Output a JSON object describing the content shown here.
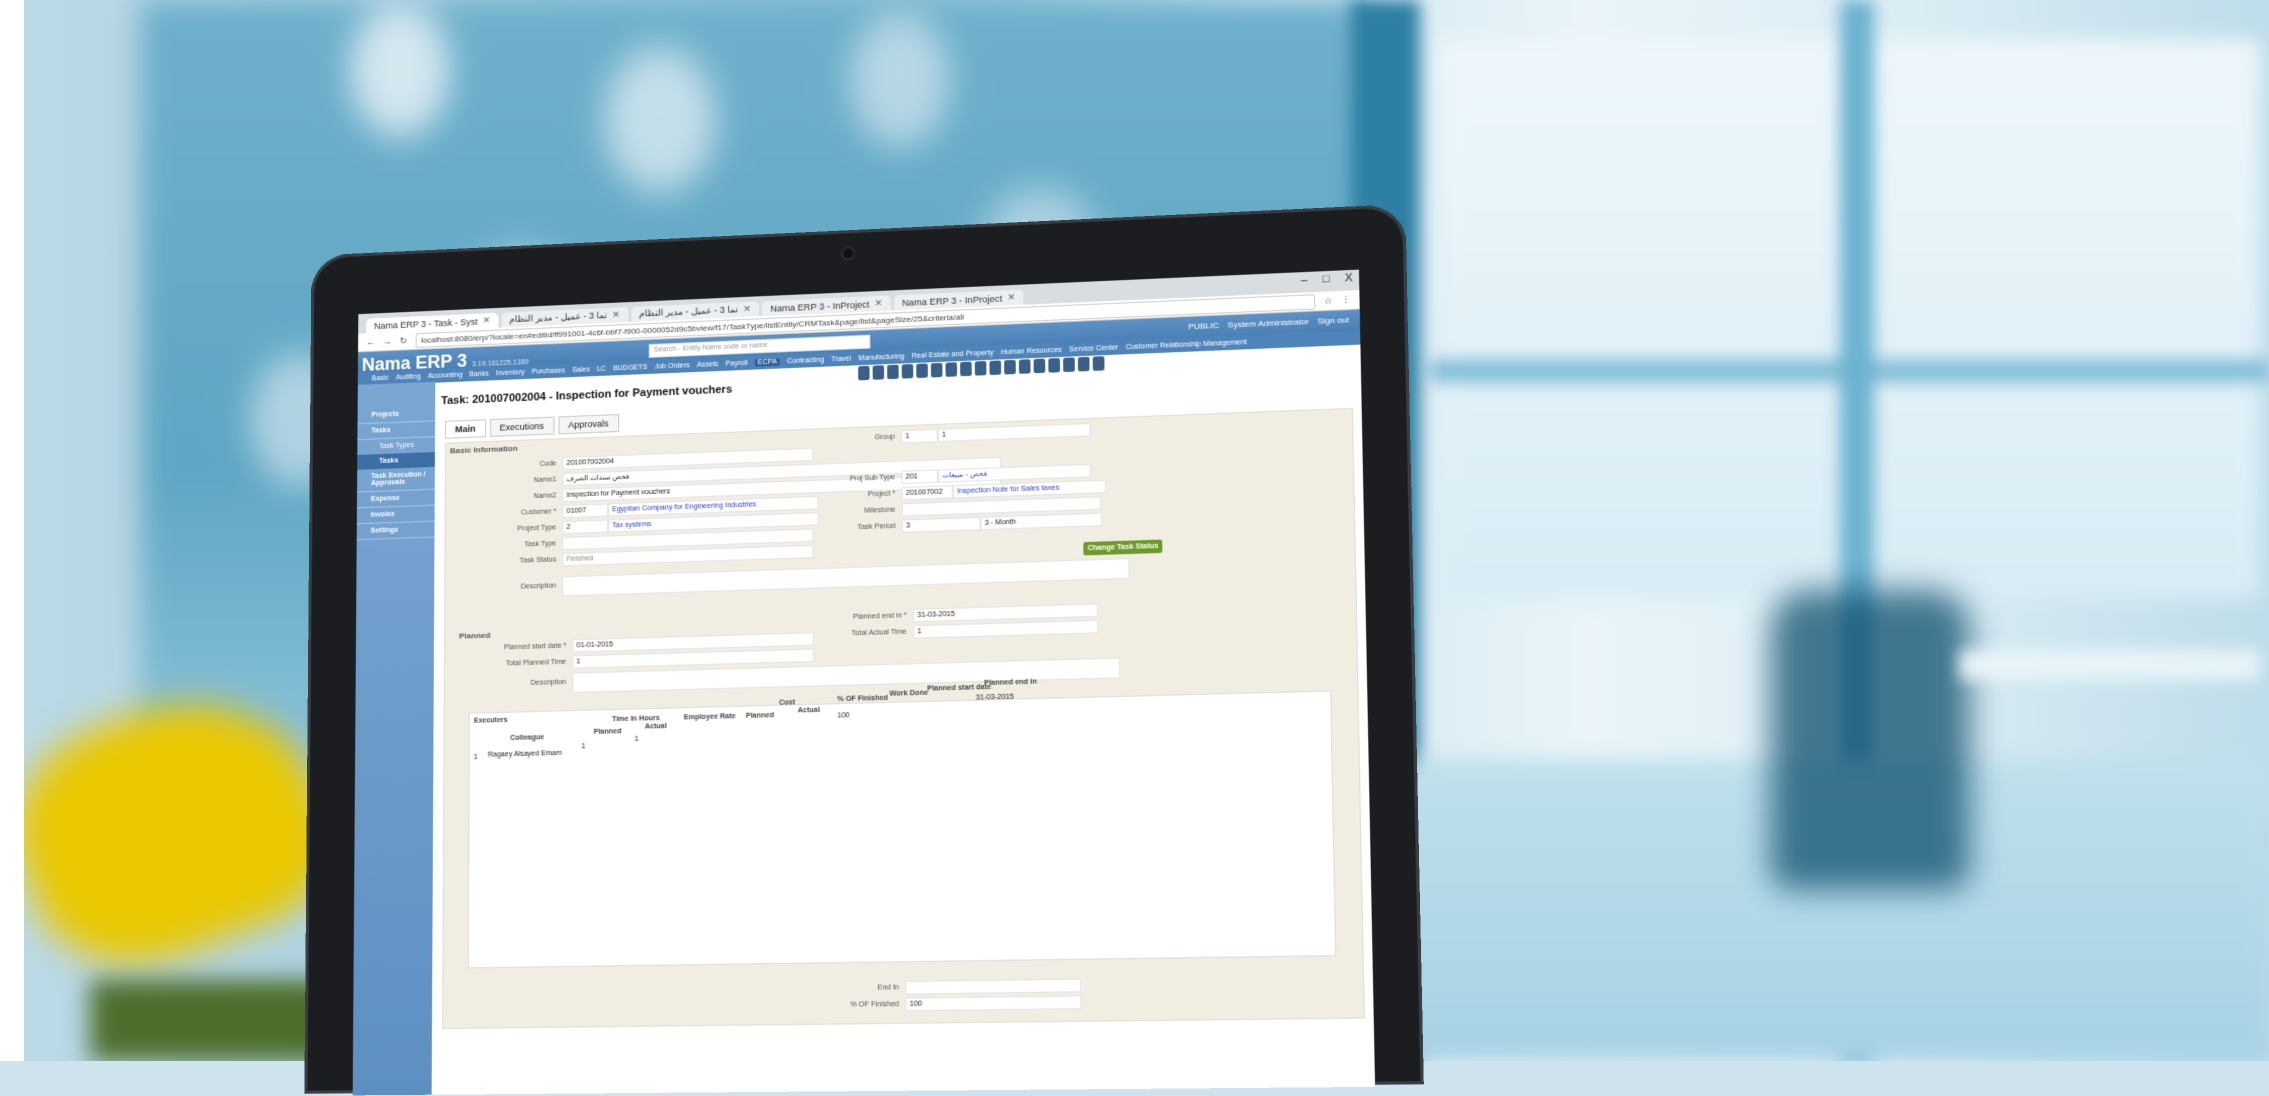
{
  "browser": {
    "tabs": [
      {
        "label": "Nama ERP 3 - Task - Syst"
      },
      {
        "label": "نما 3 - عميل - مدير النظام"
      },
      {
        "label": "نما 3 - عميل - مدير النظام"
      },
      {
        "label": "Nama ERP 3 - InProject"
      },
      {
        "label": "Nama ERP 3 - InProject"
      }
    ],
    "url": "localhost:8080/erp/?locale=en#editId/ff991001-4c6f-bbf7-f900-0000052d9c5bview/f17/TaskType/listEntity/CRMTask&page/list&pageSize/25&criteria/all",
    "window_buttons": {
      "minimize": "–",
      "maximize": "□",
      "close": "X"
    }
  },
  "app": {
    "title": "Nama ERP 3",
    "version": "3.19.161225.1389",
    "search_placeholder": "Search - Entity Name code or name",
    "user_public": "PUBLIC",
    "user_name": "System Administrator",
    "signout": "Sign out",
    "menu": [
      "Basic",
      "Auditing",
      "Accounting",
      "Banks",
      "Inventory",
      "Purchases",
      "Sales",
      "LC",
      "BUDGETS",
      "Job Orders",
      "Assets",
      "Payroll",
      "ECPA",
      "Contracting",
      "Travel",
      "Manufacturing",
      "Real Estate and Property",
      "Human Resources",
      "Service Center",
      "Customer Relationship Management"
    ],
    "menu_selected": "ECPA"
  },
  "sidebar": {
    "items": [
      {
        "label": "Projects"
      },
      {
        "label": "Tasks"
      },
      {
        "label": "Task Types"
      },
      {
        "label": "Tasks"
      },
      {
        "label": "Task Execution / Approvals"
      },
      {
        "label": "Expense"
      },
      {
        "label": "Invoice"
      },
      {
        "label": "Settings"
      }
    ]
  },
  "form": {
    "title": "Task: 201007002004 - Inspection for Payment vouchers",
    "tabs": [
      "Main",
      "Executions",
      "Approvals"
    ],
    "basic_info_title": "Basic Information",
    "code_label": "Code",
    "code": "201007002004",
    "name1_label": "Name1",
    "name1": "فحص سندات الصرف",
    "name2_label": "Name2",
    "name2": "Inspection for Payment vouchers",
    "customer_label": "Customer *",
    "customer_code": "01007",
    "customer_name": "Egyptian Company for Engineering Industries",
    "project_type_label": "Project Type",
    "project_type_code": "2",
    "project_type_name": "Tax systems",
    "task_type_label": "Task Type",
    "task_status_label": "Task Status",
    "task_status": "Finished",
    "description_label": "Description",
    "group_label": "Group",
    "group_code": "1",
    "group_name": "1",
    "proj_subtype_label": "Proj Sub Type",
    "proj_subtype_code": "201",
    "proj_subtype_name": "فحص - مبيعات",
    "project_label": "Project *",
    "project_code": "201007002",
    "project_name": "Inspection Note for Sales taxes",
    "milestone_label": "Milestone",
    "task_period_label": "Task Period",
    "task_period": "3",
    "task_period_unit": "3 - Month",
    "change_status": "Change Task Status",
    "planned_title": "Planned",
    "planned_start_label": "Planned start date *",
    "planned_start": "01-01-2015",
    "planned_end_label": "Planned end in *",
    "planned_end": "31-03-2015",
    "total_planned_label": "Total Planned Time",
    "total_planned": "1",
    "total_actual_label": "Total Actual Time",
    "total_actual": "1",
    "description2_label": "Description",
    "executers_title": "Executers",
    "grid_headers": {
      "colleague": "Colleague",
      "time_in_hours": "Time In Hours",
      "planned": "Planned",
      "actual": "Actual",
      "employee_rate": "Employee Rate",
      "cost": "Cost",
      "cost_planned": "Planned",
      "cost_actual": "Actual",
      "pct_finished": "% OF Finished",
      "work_done": "Work Done",
      "planned_start": "Planned start date",
      "planned_end": "Planned end in"
    },
    "grid_rows": [
      {
        "n": "1",
        "colleague": "Ragaey Alsayed Emam",
        "planned": "1",
        "actual": "1",
        "pct": "100",
        "planned_end": "31-03-2015"
      }
    ],
    "end_in_label": "End In",
    "pct_finished_label": "% OF Finished",
    "pct_finished": "100"
  }
}
